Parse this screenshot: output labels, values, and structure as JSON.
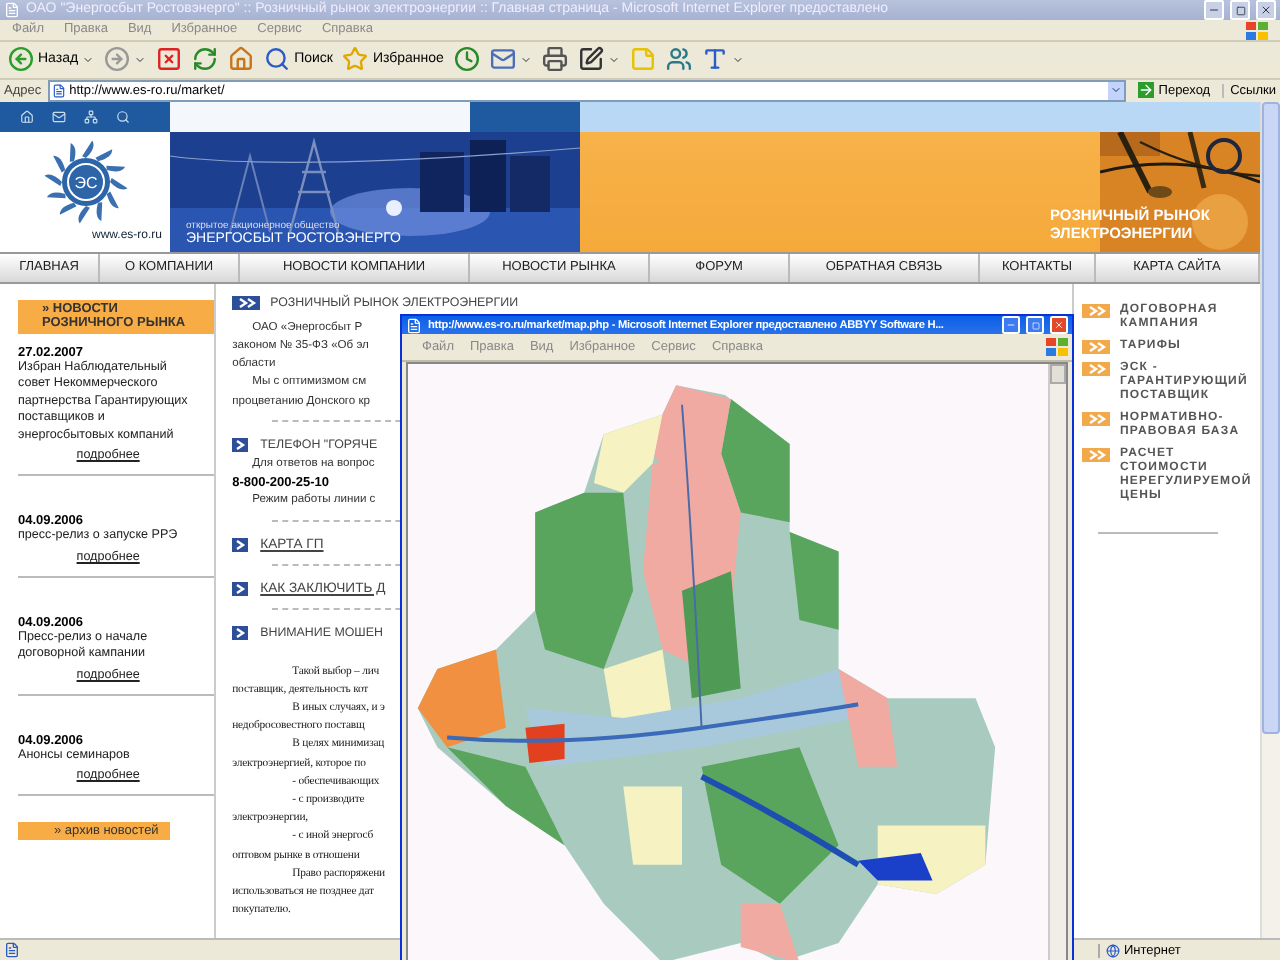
{
  "window": {
    "title": "ОАО \"Энергосбыт Ростовэнерго\" :: Розничный рынок электроэнергии :: Главная страница - Microsoft Internet Explorer предоставлено",
    "menu": [
      "Файл",
      "Правка",
      "Вид",
      "Избранное",
      "Сервис",
      "Справка"
    ],
    "toolbar": [
      {
        "kind": "back",
        "label": "Назад",
        "dropdown": true
      },
      {
        "kind": "forward",
        "dropdown": true
      },
      {
        "kind": "stop",
        "dropdown": false
      },
      {
        "kind": "refresh",
        "dropdown": false
      },
      {
        "kind": "home",
        "dropdown": false
      },
      {
        "kind": "search",
        "label": "Поиск",
        "dropdown": false
      },
      {
        "kind": "favorites",
        "label": "Избранное",
        "dropdown": false
      },
      {
        "kind": "history",
        "dropdown": false
      },
      {
        "kind": "mail",
        "dropdown": true
      },
      {
        "kind": "print",
        "dropdown": false
      },
      {
        "kind": "edit",
        "dropdown": true
      },
      {
        "kind": "notes",
        "dropdown": false
      },
      {
        "kind": "messenger",
        "dropdown": false
      },
      {
        "kind": "font",
        "dropdown": true
      }
    ],
    "address": {
      "label": "Адрес",
      "value": "http://www.es-ro.ru/market/",
      "go": "Переход",
      "links": "Ссылки"
    }
  },
  "page": {
    "banner": {
      "logo": "ЭС",
      "site": "www.es-ro.ru",
      "company_type": "открытое акционерное общество",
      "company": "ЭНЕРГОСБЫТ РОСТОВЭНЕРГО",
      "slogan": "РОЗНИЧНЫЙ РЫНОК ЭЛЕКТРОЭНЕРГИИ"
    },
    "nav": [
      "ГЛАВНАЯ",
      "О КОМПАНИИ",
      "НОВОСТИ КОМПАНИИ",
      "НОВОСТИ РЫНКА",
      "ФОРУМ",
      "ОБРАТНАЯ СВЯЗЬ",
      "КОНТАКТЫ",
      "КАРТА САЙТА"
    ],
    "news": {
      "title": "» НОВОСТИ РОЗНИЧНОГО РЫНКА",
      "items": [
        {
          "date": "27.02.2007",
          "text": "Избран Наблюдательный совет Некоммерческого партнерства Гарантирующих поставщиков и энергосбытовых компаний",
          "more": "подробнее"
        },
        {
          "date": "04.09.2006",
          "text": "пресс-релиз о запуске РРЭ",
          "more": "подробнее"
        },
        {
          "date": "04.09.2006",
          "text": "Пресс-релиз о начале договорной кампании",
          "more": "подробнее"
        },
        {
          "date": "04.09.2006",
          "text": "Анонсы семинаров",
          "more": "подробнее"
        }
      ],
      "archive": "» архив новостей"
    },
    "main": {
      "title": "РОЗНИЧНЫЙ РЫНОК ЭЛЕКТРОЭНЕРГИИ",
      "blocks": [
        {
          "kind": "para",
          "lines": [
            "ОАО «Энергосбыт Р",
            "законом № 35-ФЗ «Об эл",
            "области"
          ]
        },
        {
          "kind": "para",
          "lines": [
            "Мы с оптимизмом см",
            "процветанию Донского кр"
          ]
        },
        {
          "kind": "rule"
        },
        {
          "kind": "heading",
          "text": "ТЕЛЕФОН \"ГОРЯЧЕ"
        },
        {
          "kind": "para",
          "lines": [
            "Для ответов на вопрос"
          ]
        },
        {
          "kind": "phone",
          "text": "8-800-200-25-10"
        },
        {
          "kind": "para",
          "lines": [
            "Режим работы линии с"
          ]
        },
        {
          "kind": "rule"
        },
        {
          "kind": "link",
          "text": "КАРТА ГП"
        },
        {
          "kind": "rule"
        },
        {
          "kind": "link",
          "text": "КАК ЗАКЛЮЧИТЬ Д"
        },
        {
          "kind": "rule"
        },
        {
          "kind": "heading",
          "text": "ВНИМАНИЕ МОШЕН"
        },
        {
          "kind": "serif",
          "lines": [
            "Такой выбор – лич",
            "поставщик, деятельность кот",
            "В иных случаях, и э",
            "недобросовестного поставщ",
            "В целях минимизац",
            "электроэнергией, которое по",
            "- обеспечивающих",
            "- с производите",
            "электроэнергии,",
            "- с иной энергосб",
            "оптовом рынке в отношени",
            "Право распоряжени",
            "использоваться не позднее дат",
            "покупателю."
          ]
        }
      ]
    },
    "side_links": [
      "ДОГОВОРНАЯ КАМПАНИЯ",
      "ТАРИФЫ",
      "ЭСК - ГАРАНТИРУЮЩИЙ ПОСТАВЩИК",
      "НОРМАТИВНО-ПРАВОВАЯ БАЗА",
      "РАСЧЕТ СТОИМОСТИ НЕРЕГУЛИРУЕМОЙ ЦЕНЫ"
    ]
  },
  "popup": {
    "title": "http://www.es-ro.ru/market/map.php - Microsoft Internet Explorer предоставлено ABBYY Software H...",
    "menu": [
      "Файл",
      "Правка",
      "Вид",
      "Избранное",
      "Сервис",
      "Справка"
    ]
  },
  "status_bar": {
    "zone": "Интернет"
  }
}
